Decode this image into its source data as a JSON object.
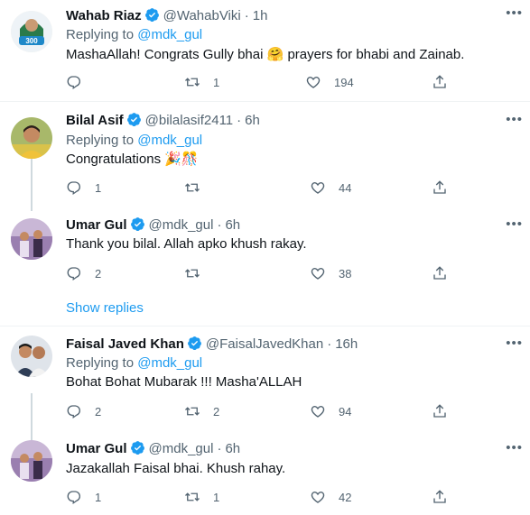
{
  "tweets": [
    {
      "name": "Wahab Riaz",
      "handle": "@WahabViki",
      "dot": "·",
      "time": "1h",
      "replying_prefix": "Replying to ",
      "replying_to": "@mdk_gul",
      "text": "MashaAllah! Congrats Gully bhai 🤗 prayers for bhabi and Zainab.",
      "replies": "",
      "retweets": "1",
      "likes": "194",
      "avatar_color": "#1e88c8"
    },
    {
      "name": "Bilal Asif",
      "handle": "@bilalasif2411",
      "dot": "·",
      "time": "6h",
      "replying_prefix": "Replying to ",
      "replying_to": "@mdk_gul",
      "text": "Congratulations 🎉🎊",
      "replies": "1",
      "retweets": "",
      "likes": "44",
      "avatar_color": "#7a8a3a"
    },
    {
      "name": "Umar Gul",
      "handle": "@mdk_gul",
      "dot": "·",
      "time": "6h",
      "text": "Thank you bilal. Allah apko khush rakay.",
      "replies": "2",
      "retweets": "",
      "likes": "38",
      "avatar_color": "#8c6fa0"
    },
    {
      "name": "Faisal Javed Khan",
      "handle": "@FaisalJavedKhan",
      "dot": "·",
      "time": "16h",
      "replying_prefix": "Replying to ",
      "replying_to": "@mdk_gul",
      "text": "Bohat Bohat Mubarak !!! Masha'ALLAH",
      "replies": "2",
      "retweets": "2",
      "likes": "94",
      "avatar_color": "#5a6e8a"
    },
    {
      "name": "Umar Gul",
      "handle": "@mdk_gul",
      "dot": "·",
      "time": "6h",
      "text": "Jazakallah Faisal bhai. Khush rahay.",
      "replies": "1",
      "retweets": "1",
      "likes": "42",
      "avatar_color": "#8c6fa0"
    }
  ],
  "show_replies": "Show replies",
  "colors": {
    "accent": "#1d9bf0",
    "muted": "#536471",
    "line": "#cfd9de"
  },
  "icons": [
    "verified-badge-icon",
    "more-icon",
    "reply-icon",
    "retweet-icon",
    "like-icon",
    "share-icon"
  ]
}
